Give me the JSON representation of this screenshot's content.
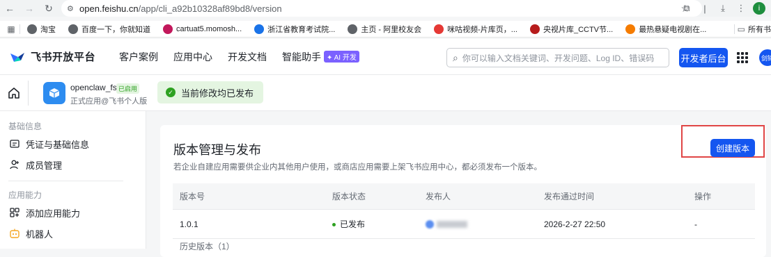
{
  "browser": {
    "url_host": "open.feishu.cn",
    "url_path": "/app/cli_a92b10328af89bd8/version",
    "profile_initial": "i",
    "bookmarks": [
      {
        "label": "淘宝",
        "color": "#5f6368"
      },
      {
        "label": "百度一下，你就知道",
        "color": "#5f6368"
      },
      {
        "label": "cartuat5.momosh...",
        "color": "#c2185b"
      },
      {
        "label": "浙江省教育考试院...",
        "color": "#1a73e8"
      },
      {
        "label": "主页 - 阿里校友会",
        "color": "#5f6368"
      },
      {
        "label": "咪咕视频-片库页，...",
        "color": "#e53935"
      },
      {
        "label": "央视片库_CCTV节...",
        "color": "#b71c1c"
      },
      {
        "label": "最热悬疑电视剧在...",
        "color": "#f57c00"
      }
    ],
    "all_bookmarks_label": "所有书"
  },
  "header": {
    "brand": "飞书开放平台",
    "nav": [
      "客户案例",
      "应用中心",
      "开发文档",
      "智能助手"
    ],
    "ai_badge": "✦ AI 开发",
    "search_placeholder": "你可以输入文档关键词、开发问题、Log ID、错误码",
    "dev_console_label": "开发者后台",
    "avatar_text": "剑锋"
  },
  "app": {
    "name": "openclaw_fs",
    "status_badge": "已启用",
    "type": "正式应用@飞书个人版",
    "publish_state": "当前修改均已发布"
  },
  "sidebar": {
    "sections": [
      {
        "title": "基础信息",
        "items": [
          {
            "label": "凭证与基础信息",
            "icon": "credential-icon"
          },
          {
            "label": "成员管理",
            "icon": "member-icon"
          }
        ]
      },
      {
        "title": "应用能力",
        "items": [
          {
            "label": "添加应用能力",
            "icon": "add-capability-icon"
          },
          {
            "label": "机器人",
            "icon": "robot-icon"
          }
        ]
      }
    ]
  },
  "main": {
    "title": "版本管理与发布",
    "description": "若企业自建应用需要供企业内其他用户使用，或商店应用需要上架飞书应用中心，都必须发布一个版本。",
    "create_version_label": "创建版本",
    "table": {
      "columns": [
        "版本号",
        "版本状态",
        "发布人",
        "发布通过时间",
        "操作"
      ],
      "rows": [
        {
          "version": "1.0.1",
          "status": "已发布",
          "publisher": "",
          "time": "2026-2-27 22:50",
          "action": "-"
        }
      ],
      "more_text": "历史版本（1）"
    }
  },
  "colors": {
    "primary": "#1456f0",
    "success": "#2ea121",
    "highlight_border": "#e04545"
  }
}
